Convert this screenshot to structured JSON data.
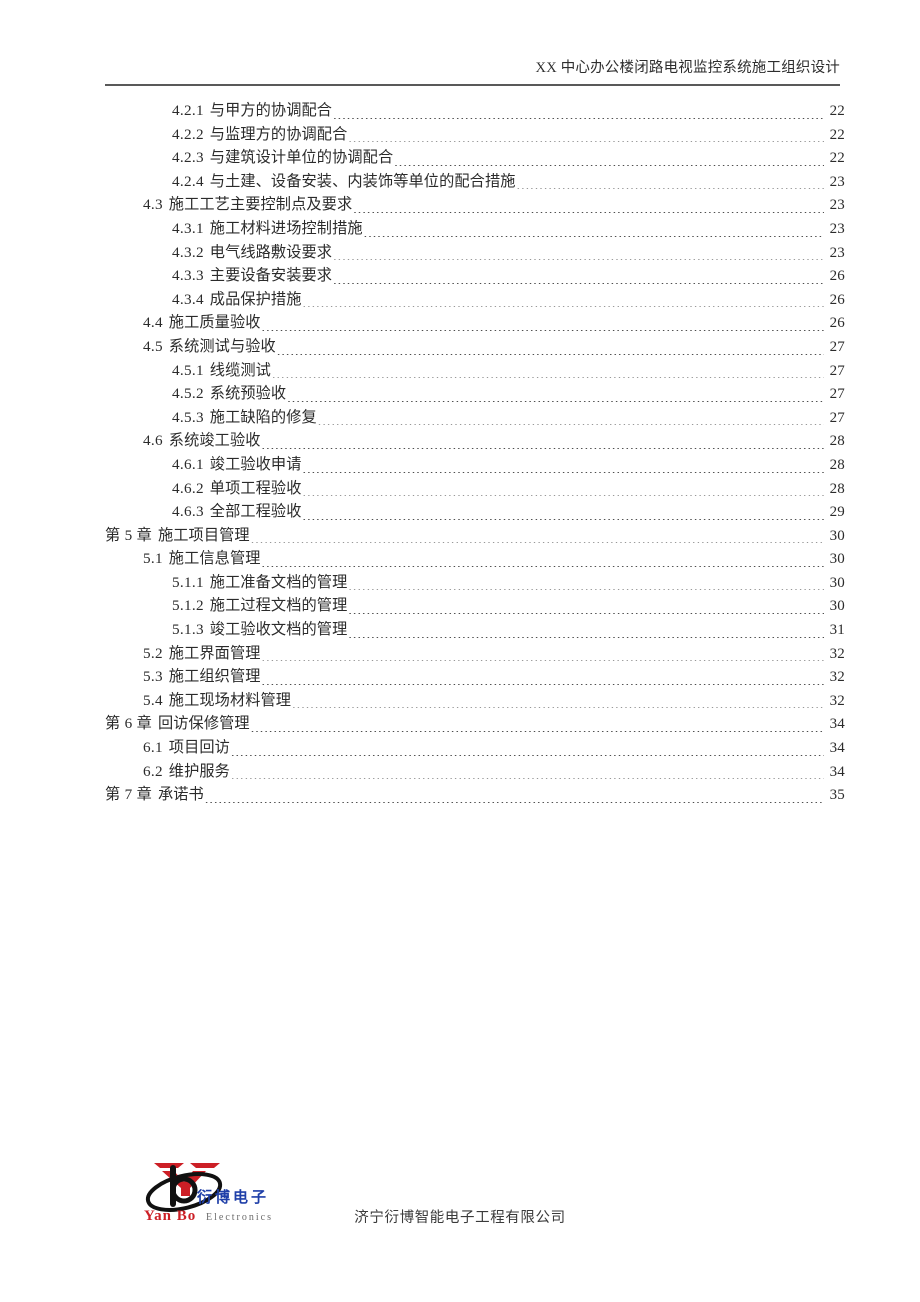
{
  "document": {
    "header_title": "XX 中心办公楼闭路电视监控系统施工组织设计",
    "footer_company": "济宁衍博智能电子工程有限公司"
  },
  "logo": {
    "cn_name": "衍博电子",
    "en_name": "Yan Bo",
    "en_sub": "Electronics",
    "monogram": "b",
    "colors": {
      "red": "#cc1f26",
      "blue": "#1f3fa8",
      "black": "#111111",
      "gray": "#6b6b6b"
    }
  },
  "toc": {
    "entries": [
      {
        "level": 3,
        "number": "4.2.1",
        "title": "与甲方的协调配合",
        "page": "22"
      },
      {
        "level": 3,
        "number": "4.2.2",
        "title": "与监理方的协调配合",
        "page": "22"
      },
      {
        "level": 3,
        "number": "4.2.3",
        "title": "与建筑设计单位的协调配合",
        "page": "22"
      },
      {
        "level": 3,
        "number": "4.2.4",
        "title": "与土建、设备安装、内装饰等单位的配合措施",
        "page": "23"
      },
      {
        "level": 2,
        "number": "4.3",
        "title": "施工工艺主要控制点及要求",
        "page": "23"
      },
      {
        "level": 3,
        "number": "4.3.1",
        "title": "施工材料进场控制措施",
        "page": "23"
      },
      {
        "level": 3,
        "number": "4.3.2",
        "title": "电气线路敷设要求",
        "page": "23"
      },
      {
        "level": 3,
        "number": "4.3.3",
        "title": "主要设备安装要求",
        "page": "26"
      },
      {
        "level": 3,
        "number": "4.3.4",
        "title": "成品保护措施",
        "page": "26"
      },
      {
        "level": 2,
        "number": "4.4",
        "title": "施工质量验收",
        "page": "26"
      },
      {
        "level": 2,
        "number": "4.5",
        "title": "系统测试与验收",
        "page": "27"
      },
      {
        "level": 3,
        "number": "4.5.1",
        "title": "线缆测试",
        "page": "27"
      },
      {
        "level": 3,
        "number": "4.5.2",
        "title": "系统预验收",
        "page": "27"
      },
      {
        "level": 3,
        "number": "4.5.3",
        "title": "施工缺陷的修复",
        "page": "27"
      },
      {
        "level": 2,
        "number": "4.6",
        "title": "系统竣工验收",
        "page": "28"
      },
      {
        "level": 3,
        "number": "4.6.1",
        "title": "竣工验收申请",
        "page": "28"
      },
      {
        "level": 3,
        "number": "4.6.2",
        "title": "单项工程验收",
        "page": "28"
      },
      {
        "level": 3,
        "number": "4.6.3",
        "title": "全部工程验收",
        "page": "29"
      },
      {
        "level": 1,
        "number": "第 5 章",
        "title": "施工项目管理",
        "page": "30"
      },
      {
        "level": 2,
        "number": "5.1",
        "title": "施工信息管理",
        "page": "30"
      },
      {
        "level": 3,
        "number": "5.1.1",
        "title": "施工准备文档的管理",
        "page": "30"
      },
      {
        "level": 3,
        "number": "5.1.2",
        "title": "施工过程文档的管理",
        "page": "30"
      },
      {
        "level": 3,
        "number": "5.1.3",
        "title": "竣工验收文档的管理",
        "page": "31"
      },
      {
        "level": 2,
        "number": "5.2",
        "title": "施工界面管理",
        "page": "32"
      },
      {
        "level": 2,
        "number": "5.3",
        "title": "施工组织管理",
        "page": "32"
      },
      {
        "level": 2,
        "number": "5.4",
        "title": "施工现场材料管理",
        "page": "32"
      },
      {
        "level": 1,
        "number": "第 6 章",
        "title": "回访保修管理",
        "page": "34"
      },
      {
        "level": 2,
        "number": "6.1",
        "title": "项目回访",
        "page": "34"
      },
      {
        "level": 2,
        "number": "6.2",
        "title": "维护服务",
        "page": "34"
      },
      {
        "level": 1,
        "number": "第 7 章",
        "title": "承诺书",
        "page": "35"
      }
    ]
  }
}
